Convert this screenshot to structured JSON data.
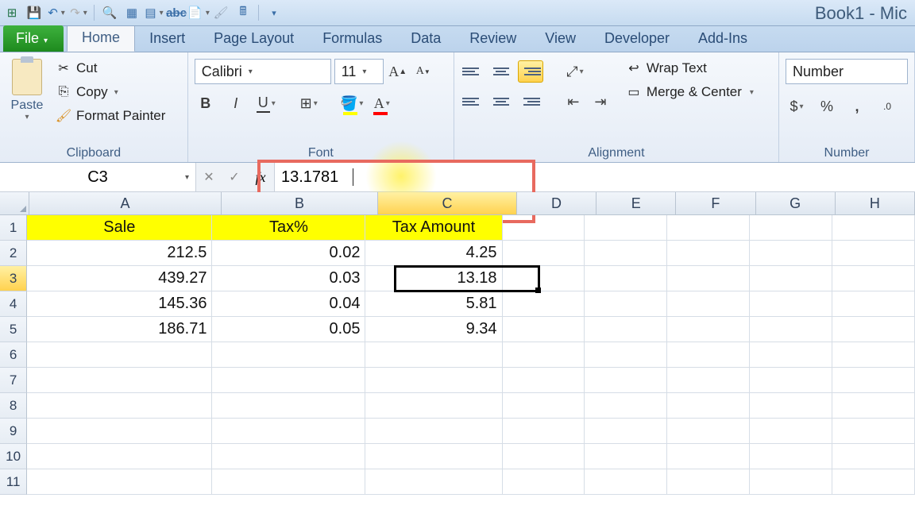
{
  "app_title": "Book1 - Mic",
  "tabs": {
    "file": "File",
    "list": [
      "Home",
      "Insert",
      "Page Layout",
      "Formulas",
      "Data",
      "Review",
      "View",
      "Developer",
      "Add-Ins"
    ],
    "active": "Home"
  },
  "clipboard": {
    "paste": "Paste",
    "cut": "Cut",
    "copy": "Copy",
    "format_painter": "Format Painter",
    "group_label": "Clipboard"
  },
  "font": {
    "name": "Calibri",
    "size": "11",
    "group_label": "Font"
  },
  "alignment": {
    "wrap": "Wrap Text",
    "merge": "Merge & Center",
    "group_label": "Alignment"
  },
  "number": {
    "format": "Number",
    "group_label": "Number"
  },
  "name_box": "C3",
  "formula_bar": {
    "value": "13.1781",
    "tooltip": "Formula Bar",
    "fx": "fx"
  },
  "columns": [
    "A",
    "B",
    "C",
    "D",
    "E",
    "F",
    "G",
    "H"
  ],
  "row_numbers": [
    "1",
    "2",
    "3",
    "4",
    "5",
    "6",
    "7",
    "8",
    "9",
    "10",
    "11"
  ],
  "headers": {
    "A": "Sale",
    "B": "Tax%",
    "C": "Tax Amount"
  },
  "rows": [
    {
      "A": "212.5",
      "B": "0.02",
      "C": "4.25"
    },
    {
      "A": "439.27",
      "B": "0.03",
      "C": "13.18"
    },
    {
      "A": "145.36",
      "B": "0.04",
      "C": "5.81"
    },
    {
      "A": "186.71",
      "B": "0.05",
      "C": "9.34"
    }
  ],
  "selected_cell": "C3"
}
